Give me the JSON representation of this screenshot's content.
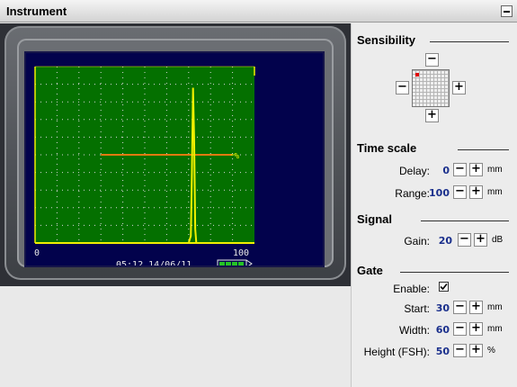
{
  "window": {
    "title": "Instrument"
  },
  "device": {
    "time": "05:12",
    "date": "14/06/11",
    "x_start_label": "0",
    "x_end_label": "100",
    "gate_marker": "%"
  },
  "chart_data": {
    "type": "line",
    "x_range": [
      0,
      100
    ],
    "y_range": [
      0,
      100
    ],
    "x": [
      0,
      70,
      71,
      71.5,
      72,
      72.5,
      73,
      73.5,
      74,
      100
    ],
    "y": [
      0,
      0,
      4,
      40,
      88,
      60,
      8,
      0,
      0,
      0
    ],
    "gate": {
      "start": 30,
      "width": 60,
      "height": 50
    },
    "grid": true,
    "colors": {
      "background": "#047000",
      "trace": "#f0f000",
      "gate": "#e07a10"
    }
  },
  "panel": {
    "sensibility": {
      "heading": "Sensibility"
    },
    "time_scale": {
      "heading": "Time scale",
      "delay": {
        "label": "Delay:",
        "value": "0",
        "unit": "mm"
      },
      "range": {
        "label": "Range:",
        "value": "100",
        "unit": "mm"
      }
    },
    "signal": {
      "heading": "Signal",
      "gain": {
        "label": "Gain:",
        "value": "20",
        "unit": "dB"
      }
    },
    "gate": {
      "heading": "Gate",
      "enable": {
        "label": "Enable:",
        "checked": true
      },
      "start": {
        "label": "Start:",
        "value": "30",
        "unit": "mm"
      },
      "width": {
        "label": "Width:",
        "value": "60",
        "unit": "mm"
      },
      "height": {
        "label": "Height (FSH):",
        "value": "50",
        "unit": "%"
      }
    }
  },
  "buttons": {
    "minus": "−",
    "plus": "+"
  }
}
